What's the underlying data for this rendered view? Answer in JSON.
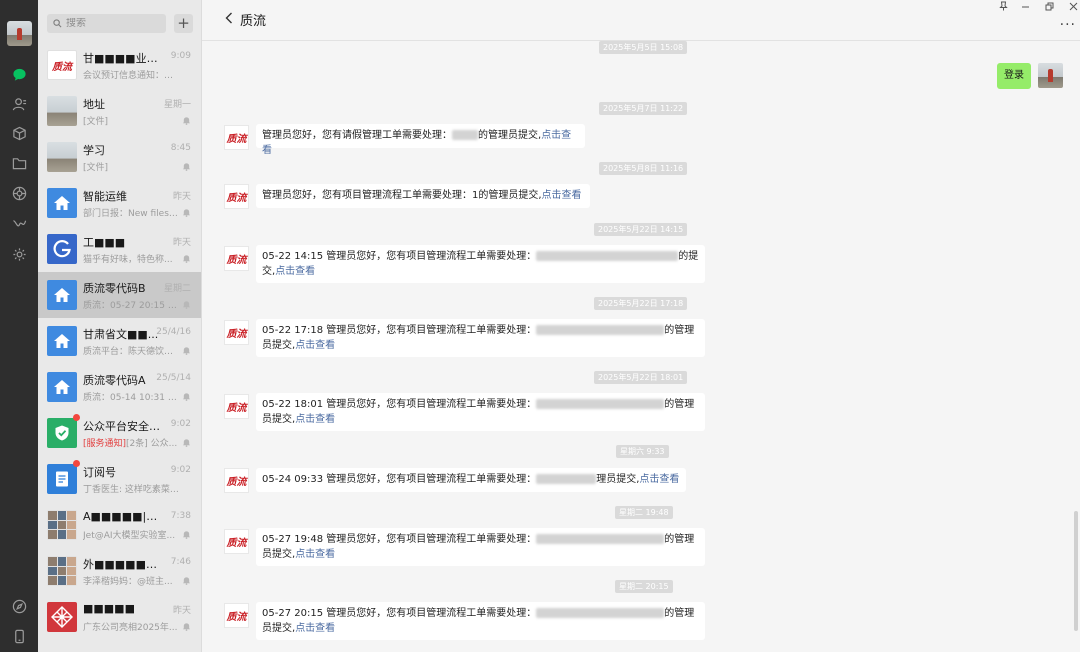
{
  "search": {
    "placeholder": "搜索"
  },
  "sessions": [
    {
      "name": "甘■■■■业服...",
      "time": "9:09",
      "preview": "会议预订信息通知：会..."
    },
    {
      "name": "地址",
      "time": "星期一",
      "preview": "[文件]"
    },
    {
      "name": "学习",
      "time": "8:45",
      "preview": "[文件]"
    },
    {
      "name": "智能运维",
      "time": "昨天",
      "preview": "部门日报：New files: 2..."
    },
    {
      "name": "工■■■",
      "time": "昨天",
      "preview": "猫乎有好味，特色称..."
    },
    {
      "name": "质流零代码B",
      "time": "星期二",
      "preview": "质流：05-27 20:15 管..."
    },
    {
      "name": "甘肃省文■■...",
      "time": "25/4/16",
      "preview": "质流平台：陈天德饮料..."
    },
    {
      "name": "质流零代码A",
      "time": "25/5/14",
      "preview": "质流：05-14 10:31 管..."
    },
    {
      "name": "公众平台安全助手",
      "time": "9:02",
      "tag": "[服务通知]",
      "preview": "[2条] 公众..."
    },
    {
      "name": "订阅号",
      "time": "9:02",
      "preview": "丁香医生: 这样吃素菜,..."
    },
    {
      "name": "A■■■■■|■...",
      "time": "7:38",
      "preview": "Jet@AI大模型实验室..."
    },
    {
      "name": "外■■■■■■...",
      "time": "7:46",
      "preview": "李泽楷妈妈：@班主..."
    },
    {
      "name": "■■■■■",
      "time": "昨天",
      "preview": "广东公司亮相2025年..."
    }
  ],
  "chat": {
    "title": "质流",
    "more_label": "···",
    "avatar_label": "质流",
    "my_message": "登录",
    "messages": [
      {
        "timestamp": "2025年5月5日 15:08"
      },
      {
        "timestamp": "2025年5月7日 11:22",
        "text": "管理员您好，您有请假管理工单需要处理：",
        "suffix": "的管理员提交,",
        "link": "点击查看"
      },
      {
        "timestamp": "2025年5月8日 11:16",
        "text": "管理员您好，您有项目管理流程工单需要处理：1的管理员提交,",
        "link": "点击查看"
      },
      {
        "timestamp": "2025年5月22日 14:15",
        "text": "05-22 14:15 管理员您好，您有项目管理流程工单需要处理：",
        "suffix": "的提",
        "line2": "交,",
        "link": "点击查看"
      },
      {
        "timestamp": "2025年5月22日 17:18",
        "text": "05-22 17:18 管理员您好，您有项目管理流程工单需要处理：",
        "suffix": "的管理",
        "line2": "员提交,",
        "link": "点击查看"
      },
      {
        "timestamp": "2025年5月22日 18:01",
        "text": "05-22 18:01 管理员您好，您有项目管理流程工单需要处理：",
        "suffix": "的管理",
        "line2": "员提交,",
        "link": "点击查看"
      },
      {
        "timestamp": "星期六 9:33",
        "text": "05-24 09:33 管理员您好，您有项目管理流程工单需要处理：",
        "suffix": "理员提交,",
        "link": "点击查看"
      },
      {
        "timestamp": "星期二 19:48",
        "text": "05-27 19:48 管理员您好，您有项目管理流程工单需要处理：",
        "suffix": "的管理",
        "line2": "员提交,",
        "link": "点击查看"
      },
      {
        "timestamp": "星期二 20:15",
        "text": "05-27 20:15 管理员您好，您有项目管理流程工单需要处理：",
        "suffix": "的管理",
        "line2": "员提交,",
        "link": "点击查看"
      }
    ]
  },
  "colors": {
    "accent_green": "#07c160",
    "my_bubble": "#95ec69",
    "link": "#4a6aa0",
    "badge_red": "#f3473f"
  }
}
